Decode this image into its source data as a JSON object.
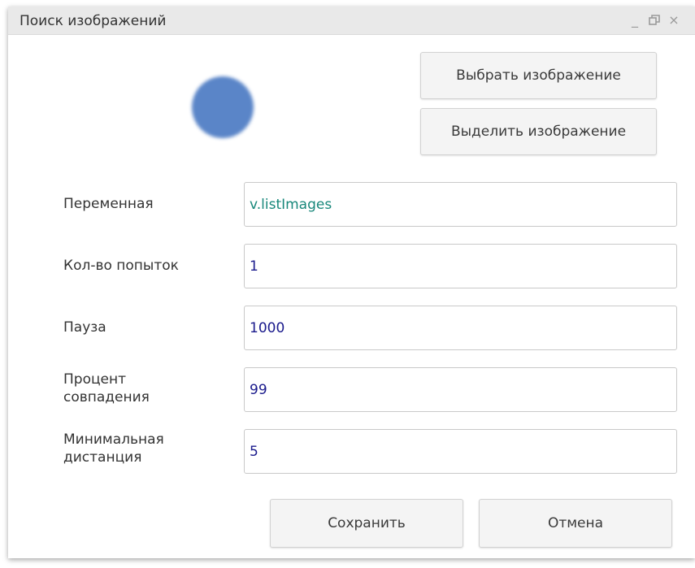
{
  "window": {
    "title": "Поиск изображений",
    "controls": {
      "minimize": "_",
      "close": "×"
    }
  },
  "image_buttons": {
    "select": "Выбрать изображение",
    "highlight": "Выделить изображение"
  },
  "fields": [
    {
      "label": "Переменная",
      "value": "v.listImages"
    },
    {
      "label": "Кол-во попыток",
      "value": "1"
    },
    {
      "label": "Пауза",
      "value": "1000"
    },
    {
      "label_line1": "Процент",
      "label_line2": "совпадения",
      "value": "99"
    },
    {
      "label_line1": "Минимальная",
      "label_line2": "дистанция",
      "value": "5"
    }
  ],
  "footer": {
    "save": "Сохранить",
    "cancel": "Отмена"
  },
  "colors": {
    "preview_dot": "#5a85c8",
    "variable_text": "#17877a",
    "number_text": "#1a1a8c"
  }
}
